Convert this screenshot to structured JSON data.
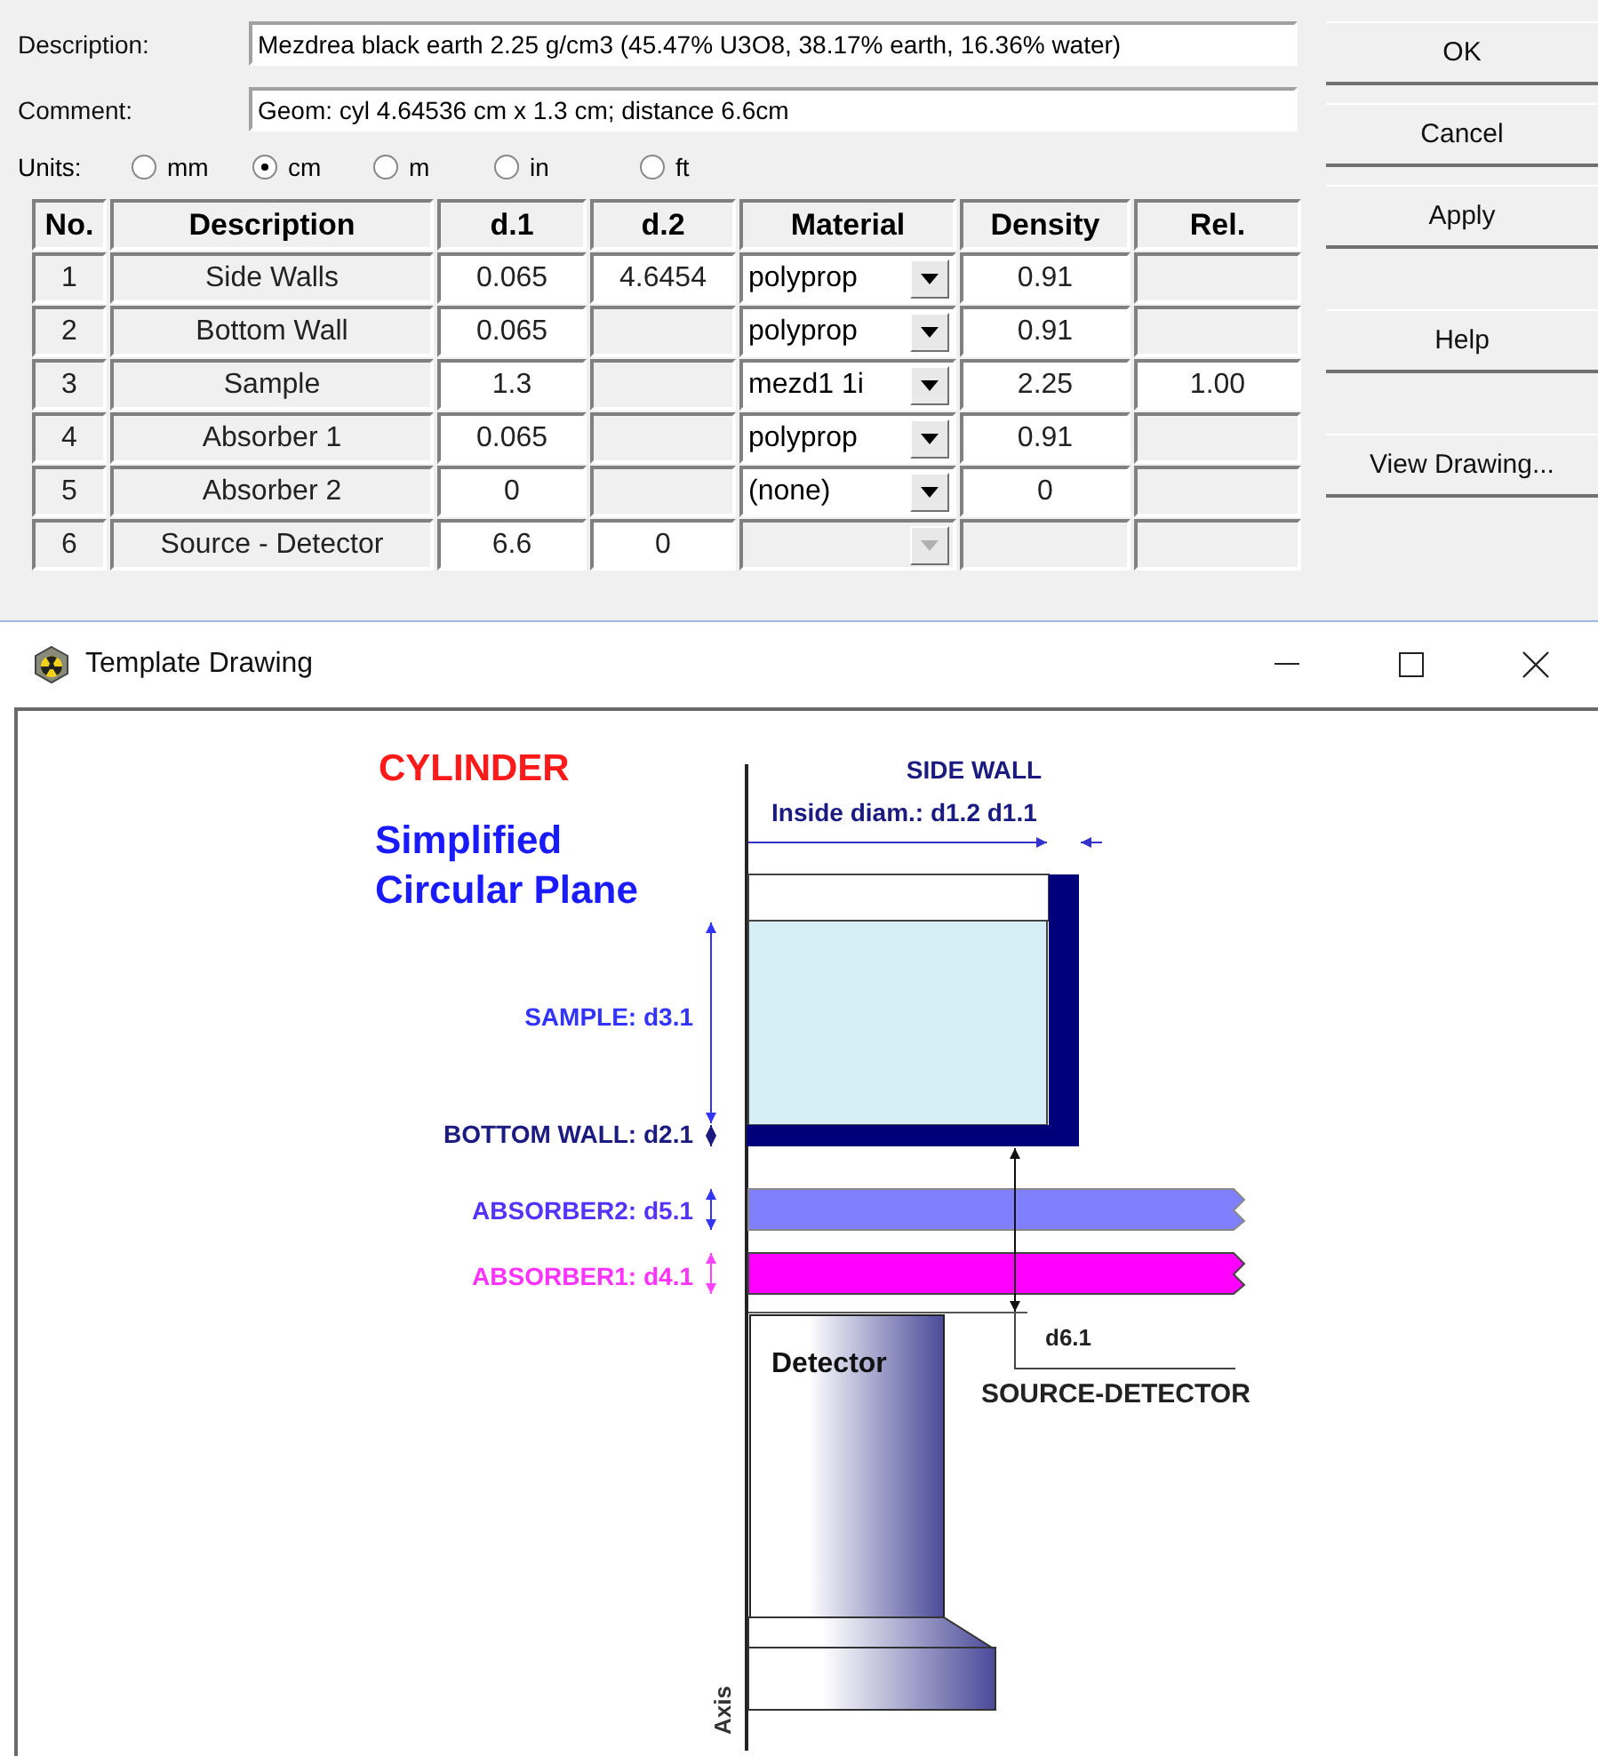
{
  "dialog": {
    "description_label": "Description:",
    "description": "Mezdrea black earth 2.25 g/cm3 (45.47% U3O8, 38.17% earth, 16.36% water)",
    "comment_label": "Comment:",
    "comment": "Geom: cyl 4.64536 cm x 1.3 cm; distance 6.6cm",
    "units_label": "Units:",
    "units": [
      {
        "label": "mm",
        "selected": false
      },
      {
        "label": "cm",
        "selected": true
      },
      {
        "label": "m",
        "selected": false
      },
      {
        "label": "in",
        "selected": false
      },
      {
        "label": "ft",
        "selected": false
      }
    ],
    "columns": [
      "No.",
      "Description",
      "d.1",
      "d.2",
      "Material",
      "Density",
      "Rel."
    ],
    "rows": [
      {
        "no": "1",
        "description": "Side Walls",
        "d1": "0.065",
        "d2": "4.6454",
        "material": {
          "value": "polyprop",
          "disabled": false
        },
        "density": "0.91"
      },
      {
        "no": "2",
        "description": "Bottom Wall",
        "d1": "0.065",
        "material": {
          "value": "polyprop",
          "disabled": false
        },
        "density": "0.91"
      },
      {
        "no": "3",
        "description": "Sample",
        "d1": "1.3",
        "material": {
          "value": "mezd1  1i",
          "disabled": false
        },
        "density": "2.25",
        "rel": "1.00"
      },
      {
        "no": "4",
        "description": "Absorber 1",
        "d1": "0.065",
        "material": {
          "value": "polyprop",
          "disabled": false
        },
        "density": "0.91"
      },
      {
        "no": "5",
        "description": "Absorber 2",
        "d1": "0",
        "material": {
          "value": "(none)",
          "disabled": false
        },
        "density": "0"
      },
      {
        "no": "6",
        "description": "Source - Detector",
        "d1": "6.6",
        "d2": "0",
        "material": {
          "disabled": true
        }
      }
    ],
    "button_groups": [
      [
        "OK",
        "Cancel",
        "Apply"
      ],
      [
        "Help"
      ],
      [
        "View Drawing..."
      ]
    ]
  },
  "window": {
    "title": "Template Drawing"
  },
  "drawing": {
    "title": "CYLINDER",
    "subtitle": [
      "Simplified",
      "Circular Plane"
    ],
    "side_wall": "SIDE WALL",
    "inside_diam": "Inside diam.:  d1.2 d1.1",
    "sample": "SAMPLE:  d3.1",
    "bottom_wall": "BOTTOM WALL:  d2.1",
    "absorber2": "ABSORBER2:  d5.1",
    "absorber1": "ABSORBER1:  d4.1",
    "d6": "d6.1",
    "source_detector": "SOURCE-DETECTOR",
    "detector": "Detector",
    "axis": "Axis"
  }
}
